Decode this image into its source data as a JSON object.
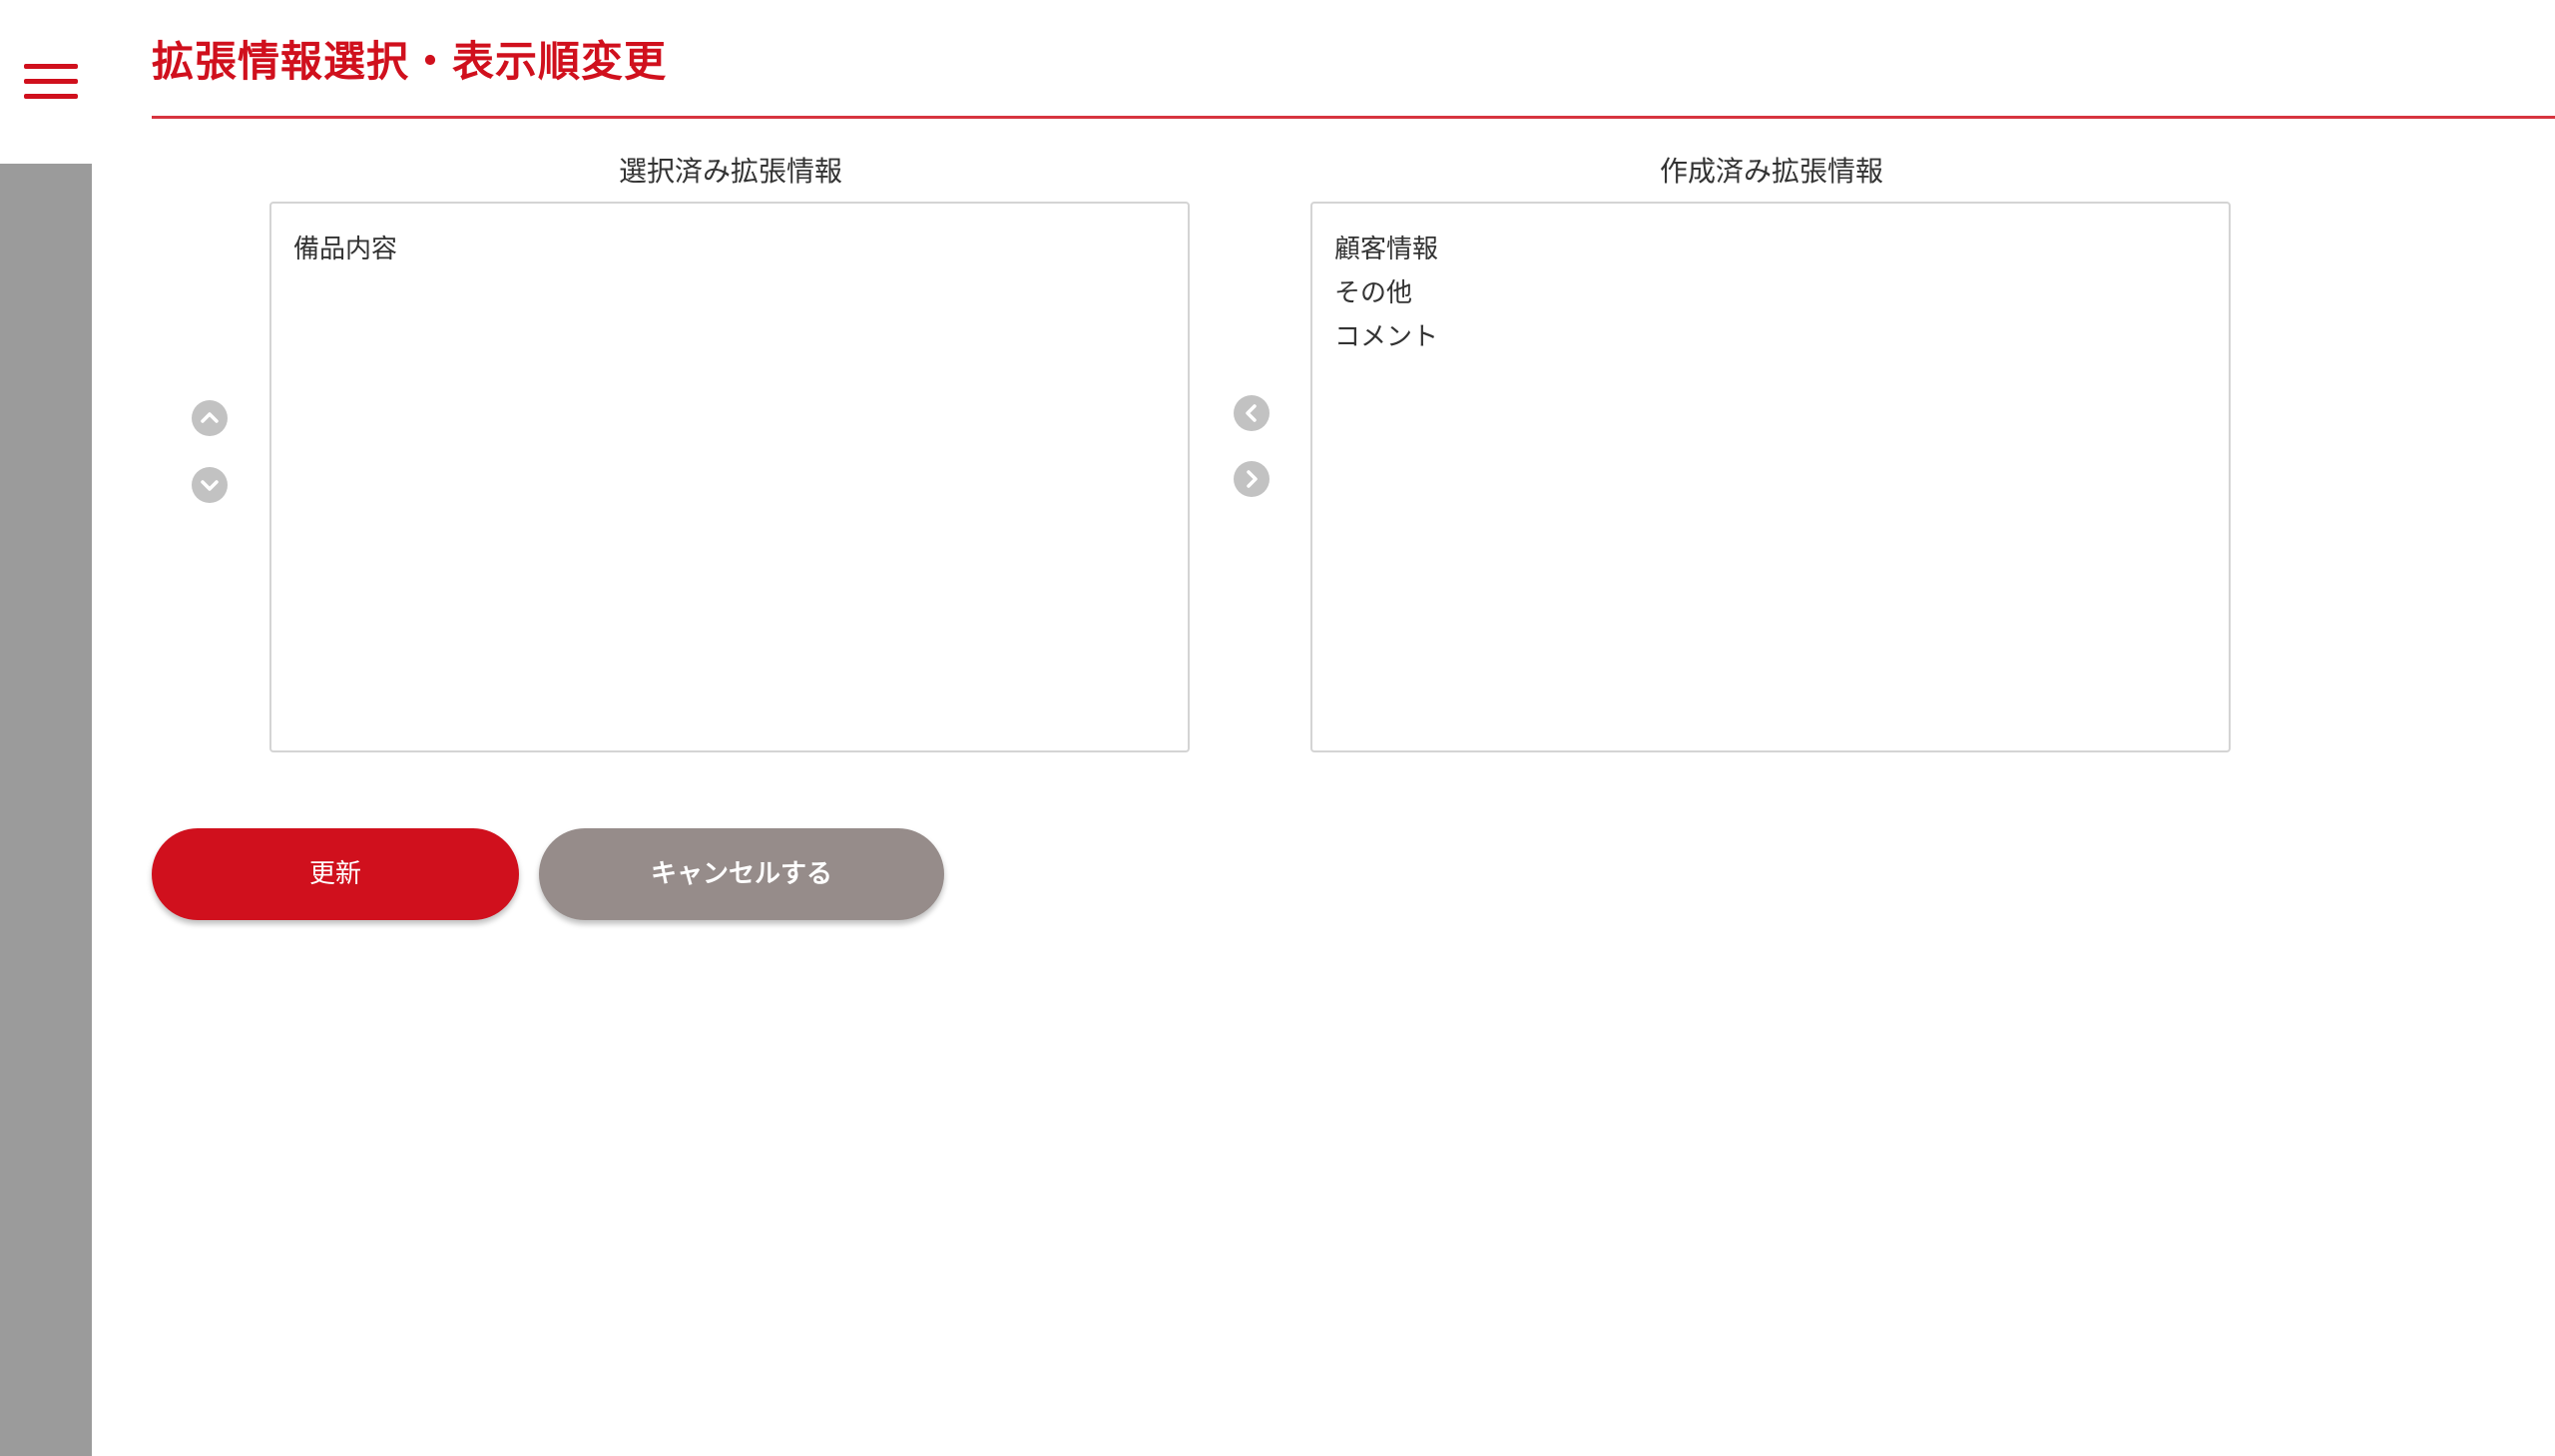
{
  "colors": {
    "accent": "#d0101d",
    "cancel_bg": "#968c8a",
    "sidebar_bg": "#9b9b9b"
  },
  "header": {
    "title": "拡張情報選択・表示順変更"
  },
  "selected_panel": {
    "label": "選択済み拡張情報",
    "items": [
      "備品内容"
    ]
  },
  "available_panel": {
    "label": "作成済み拡張情報",
    "items": [
      "顧客情報",
      "その他",
      "コメント"
    ]
  },
  "icons": {
    "menu": "hamburger-menu-icon",
    "move_up": "chevron-up-icon",
    "move_down": "chevron-down-icon",
    "move_left": "chevron-left-icon",
    "move_right": "chevron-right-icon"
  },
  "actions": {
    "update_label": "更新",
    "cancel_label": "キャンセルする"
  }
}
